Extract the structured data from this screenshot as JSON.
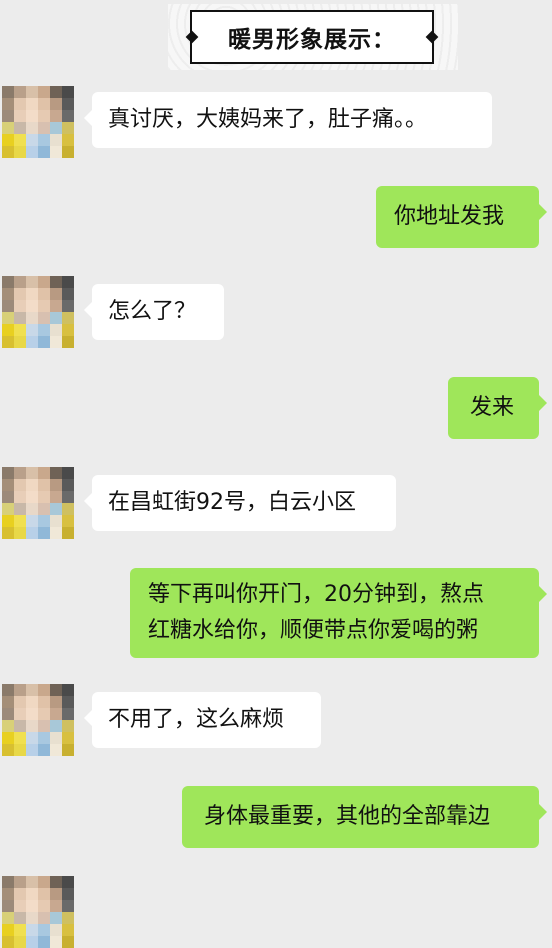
{
  "banner": {
    "title": "暖男形象展示："
  },
  "messages": [
    {
      "side": "left",
      "text": "真讨厌，大姨妈来了，肚子痛。。"
    },
    {
      "side": "right",
      "text": "你地址发我"
    },
    {
      "side": "left",
      "text": "怎么了？"
    },
    {
      "side": "right",
      "text": "发来"
    },
    {
      "side": "left",
      "text": "在昌虹街92号，白云小区"
    },
    {
      "side": "right",
      "lines": [
        "等下再叫你开门，20分钟到，熬点",
        "红糖水给你，顺便带点你爱喝的粥"
      ]
    },
    {
      "side": "left",
      "text": "不用了，这么麻烦"
    },
    {
      "side": "right",
      "text": "身体最重要，其他的全部靠边"
    }
  ],
  "colors": {
    "background": "#ececec",
    "bubble_left": "#ffffff",
    "bubble_right": "#9fe65a"
  }
}
